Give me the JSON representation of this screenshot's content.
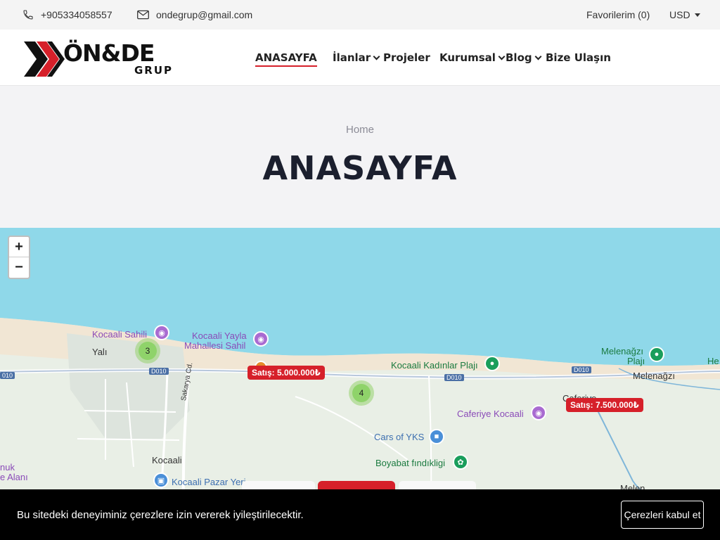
{
  "topbar": {
    "phone": "+905334058557",
    "email": "ondegrup@gmail.com",
    "favorites": "Favorilerim (0)",
    "currency": "USD"
  },
  "logo": {
    "main": "ÖN&DE",
    "sub": "GRUP"
  },
  "nav": {
    "items": [
      {
        "label": "ANASAYFA",
        "active": true
      },
      {
        "label": "İlanlar",
        "dropdown": true
      },
      {
        "label": "Projeler"
      },
      {
        "label": "Kurumsal",
        "dropdown": true
      },
      {
        "label": "Blog",
        "dropdown": true
      },
      {
        "label": "Bize Ulaşın"
      }
    ]
  },
  "hero": {
    "breadcrumb": "Home",
    "title": "ANASAYFA"
  },
  "map": {
    "zoom_in": "+",
    "zoom_out": "−",
    "labels": {
      "kocaali_sahili": "Kocaali Sahili",
      "kocaali_yayla_1": "Kocaali Yayla",
      "kocaali_yayla_2": "Mahallesi Sahil",
      "yali": "Yalı",
      "kadinlar_plaji": "Kocaali Kadınlar Plajı",
      "melenagzi_1": "Melenağzı",
      "melenagzi_2": "Plajı",
      "melenagzi_town": "Melenağzı",
      "he": "He",
      "caferiye": "Caferiye",
      "caferiye_kocaali": "Caferiye Kocaali",
      "cars_of_yks": "Cars of YKS",
      "boyabat": "Boyabat fındıkligi",
      "kocaali": "Kocaali",
      "pazar_yeri": "Kocaali Pazar Yeri",
      "sakarya_cd": "Sakarya Cd.",
      "nuk": "nuk",
      "alani": "e Alanı",
      "melen": "Melen",
      "d010_a": "D010",
      "d010_b": "D010",
      "d010_c": "D010",
      "d010_d": "010"
    },
    "clusters": [
      "3",
      "4"
    ],
    "prices": [
      "Satış: 5.000.000₺",
      "Satış: 7.500.000₺"
    ]
  },
  "cookie": {
    "text": "Bu sitedeki deneyiminiz çerezlere izin vererek iyileştirilecektir.",
    "button": "Çerezleri kabul et"
  },
  "colors": {
    "accent": "#d6202a",
    "sea": "#8fd8e9",
    "land": "#e8efe4",
    "dark": "#1b1f2e"
  }
}
